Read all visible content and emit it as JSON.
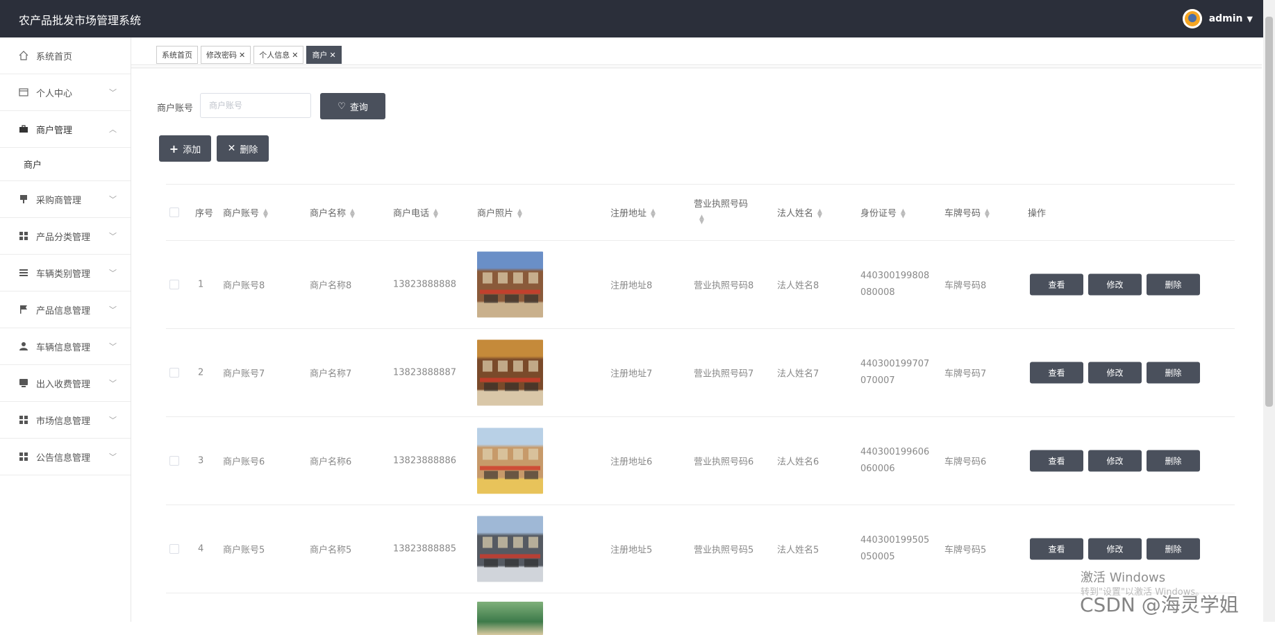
{
  "app": {
    "title": "农产品批发市场管理系统",
    "user": "admin"
  },
  "sidebar": {
    "items": [
      {
        "label": "系统首页",
        "icon": "home-icon",
        "chev": false
      },
      {
        "label": "个人中心",
        "icon": "card-icon",
        "chev": true
      },
      {
        "label": "商户管理",
        "icon": "briefcase-icon",
        "chev": true,
        "open": true,
        "sub": [
          "商户"
        ]
      },
      {
        "label": "采购商管理",
        "icon": "stand-icon",
        "chev": true
      },
      {
        "label": "产品分类管理",
        "icon": "grid-icon",
        "chev": true
      },
      {
        "label": "车辆类别管理",
        "icon": "list-icon",
        "chev": true
      },
      {
        "label": "产品信息管理",
        "icon": "flag-icon",
        "chev": true
      },
      {
        "label": "车辆信息管理",
        "icon": "user-icon",
        "chev": true
      },
      {
        "label": "出入收费管理",
        "icon": "monitor-icon",
        "chev": true
      },
      {
        "label": "市场信息管理",
        "icon": "grid-icon",
        "chev": true
      },
      {
        "label": "公告信息管理",
        "icon": "grid-icon",
        "chev": true
      }
    ]
  },
  "tabs": [
    {
      "label": "系统首页",
      "close": false,
      "active": false
    },
    {
      "label": "修改密码",
      "close": true,
      "active": false
    },
    {
      "label": "个人信息",
      "close": true,
      "active": false
    },
    {
      "label": "商户",
      "close": true,
      "active": true
    }
  ],
  "search": {
    "label": "商户账号",
    "placeholder": "商户账号",
    "button": "查询"
  },
  "actions": {
    "add": "添加",
    "delete": "删除"
  },
  "table": {
    "headers": {
      "index": "序号",
      "account": "商户账号",
      "name": "商户名称",
      "phone": "商户电话",
      "photo": "商户照片",
      "address": "注册地址",
      "license": "营业执照号码",
      "legal": "法人姓名",
      "idcard": "身份证号",
      "plate": "车牌号码",
      "ops": "操作"
    },
    "rows": [
      {
        "index": "1",
        "account": "商户账号8",
        "name": "商户名称8",
        "phone": "13823888888",
        "address": "注册地址8",
        "license": "营业执照号码8",
        "legal": "法人姓名8",
        "id1": "440300199808",
        "id2": "080008",
        "plate": "车牌号码8"
      },
      {
        "index": "2",
        "account": "商户账号7",
        "name": "商户名称7",
        "phone": "13823888887",
        "address": "注册地址7",
        "license": "营业执照号码7",
        "legal": "法人姓名7",
        "id1": "440300199707",
        "id2": "070007",
        "plate": "车牌号码7"
      },
      {
        "index": "3",
        "account": "商户账号6",
        "name": "商户名称6",
        "phone": "13823888886",
        "address": "注册地址6",
        "license": "营业执照号码6",
        "legal": "法人姓名6",
        "id1": "440300199606",
        "id2": "060006",
        "plate": "车牌号码6"
      },
      {
        "index": "4",
        "account": "商户账号5",
        "name": "商户名称5",
        "phone": "13823888885",
        "address": "注册地址5",
        "license": "营业执照号码5",
        "legal": "法人姓名5",
        "id1": "440300199505",
        "id2": "050005",
        "plate": "车牌号码5"
      }
    ],
    "ops": {
      "view": "查看",
      "edit": "修改",
      "delete": "删除"
    }
  },
  "watermark": {
    "line1": "激活 Windows",
    "line2": "转到\"设置\"以激活 Windows。",
    "csdn": "CSDN @海灵学姐"
  },
  "colors": {
    "topbar": "#2b2f3a",
    "button": "#4a505c"
  }
}
